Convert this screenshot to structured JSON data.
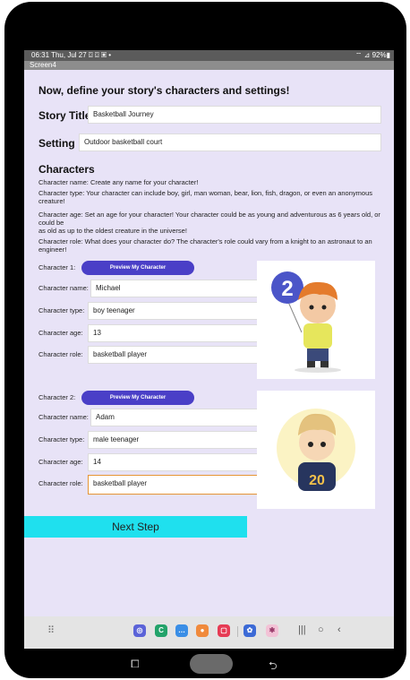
{
  "status_bar": {
    "left": "06:31  Thu, Jul 27  ⌼ ⌼ ▣ •",
    "right": "⌔ ⊿ 92%▮"
  },
  "window": {
    "title": "Screen4"
  },
  "main": {
    "heading": "Now, define your story's characters and settings!",
    "story_title_label": "Story Title",
    "story_title_value": "Basketball Journey",
    "setting_label": "Setting",
    "setting_value": "Outdoor basketball court",
    "characters_heading": "Characters",
    "desc_name": "Character name: Create any name for your character!",
    "desc_type": "Character type: Your character can include boy, girl, man woman, bear, lion, fish, dragon, or even an anonymous creature!",
    "desc_age_1": "Character age: Set an age for your character! Your character could be as young and adventurous as 6 years old, or could be",
    "desc_age_2": " as old as up to the oldest creature in the universe!",
    "desc_role": "Character role: What does your character do? The character's role could vary from a knight to an astronaut to an engineer!",
    "characters": [
      {
        "header": "Character 1:",
        "preview_label": "Preview My Character",
        "name_label": "Character name:",
        "name": "Michael",
        "type_label": "Character type:",
        "type": "boy teenager",
        "age_label": "Character age:",
        "age": "13",
        "role_label": "Character role:",
        "role": "basketball player"
      },
      {
        "header": "Character 2:",
        "preview_label": "Preview My Character",
        "name_label": "Character name:",
        "name": "Adam",
        "type_label": "Character type:",
        "type": "male teenager",
        "age_label": "Character age:",
        "age": "14",
        "role_label": "Character role:",
        "role": "basketball player"
      }
    ],
    "next_label": "Next Step"
  },
  "colors": {
    "screen_bg": "#e8e3f7",
    "preview_btn": "#4a3fc7",
    "next_btn": "#1fe0ee",
    "active_border": "#e59535"
  },
  "illustrations": {
    "char1_badge": "2",
    "char2_jersey": "20"
  },
  "nav_apps": [
    "samsung-internet-icon",
    "camera-app-icon",
    "messages-icon",
    "contacts-icon",
    "screen-recorder-icon",
    "settings-icon",
    "galaxy-store-icon"
  ]
}
